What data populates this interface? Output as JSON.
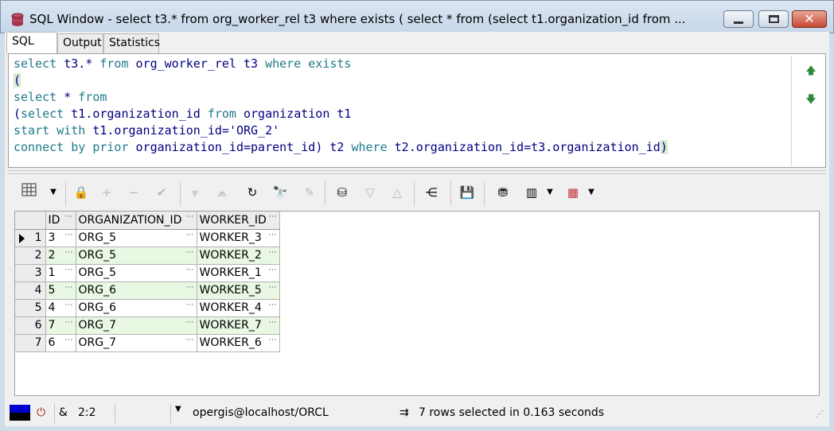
{
  "window": {
    "title": "SQL Window - select t3.* from org_worker_rel t3 where exists ( select * from (select t1.organization_id from  ..."
  },
  "tabs": [
    {
      "label": "SQL"
    },
    {
      "label": "Output"
    },
    {
      "label": "Statistics"
    }
  ],
  "editor": {
    "lines": [
      "select t3.* from org_worker_rel t3 where exists",
      "(",
      "select * from",
      "(select t1.organization_id from organization t1",
      "start with t1.organization_id='ORG_2'",
      "connect by prior organization_id=parent_id) t2 where t2.organization_id=t3.organization_id)"
    ]
  },
  "grid": {
    "columns": [
      "",
      "ID",
      "ORGANIZATION_ID",
      "WORKER_ID"
    ],
    "rows": [
      {
        "rownum": "1",
        "id": "3",
        "org": "ORG_5",
        "worker": "WORKER_3"
      },
      {
        "rownum": "2",
        "id": "2",
        "org": "ORG_5",
        "worker": "WORKER_2"
      },
      {
        "rownum": "3",
        "id": "1",
        "org": "ORG_5",
        "worker": "WORKER_1"
      },
      {
        "rownum": "4",
        "id": "5",
        "org": "ORG_6",
        "worker": "WORKER_5"
      },
      {
        "rownum": "5",
        "id": "4",
        "org": "ORG_6",
        "worker": "WORKER_4"
      },
      {
        "rownum": "6",
        "id": "7",
        "org": "ORG_7",
        "worker": "WORKER_7"
      },
      {
        "rownum": "7",
        "id": "6",
        "org": "ORG_7",
        "worker": "WORKER_6"
      }
    ]
  },
  "status": {
    "position": "2:2",
    "connection": "opergis@localhost/ORCL",
    "message": "7 rows selected in 0.163 seconds",
    "amp": "&"
  },
  "colors": {
    "alt_row": "#e8f8e3",
    "keyword": "#1f7a8c",
    "identifier": "#000080"
  }
}
